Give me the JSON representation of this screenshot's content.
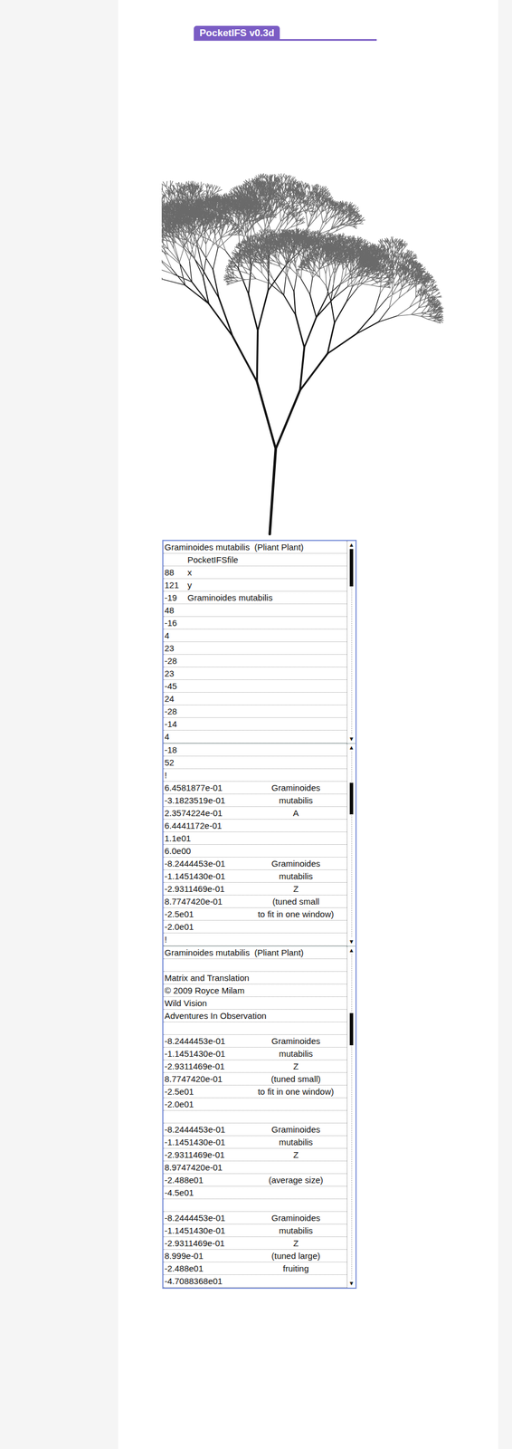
{
  "app": {
    "title": "PocketIFS v0.3d"
  },
  "list": {
    "sections": [
      {
        "kind": "listing",
        "scroll": {
          "up": "▲",
          "down": "▼",
          "level": 0.0,
          "thumb": 0.2
        },
        "rows": [
          {
            "value": "Graminoides mutabilis  (Pliant Plant)",
            "note": ""
          },
          {
            "value": "",
            "note": "PocketIFSfile"
          },
          {
            "value": "88",
            "note": "x"
          },
          {
            "value": "121",
            "note": "y"
          },
          {
            "value": "-19",
            "note": "Graminoides mutabilis"
          },
          {
            "value": "48",
            "note": ""
          },
          {
            "value": "-16",
            "note": ""
          },
          {
            "value": "4",
            "note": ""
          },
          {
            "value": "23",
            "note": ""
          },
          {
            "value": "-28",
            "note": ""
          },
          {
            "value": "23",
            "note": ""
          },
          {
            "value": "-45",
            "note": ""
          },
          {
            "value": "24",
            "note": ""
          },
          {
            "value": "-28",
            "note": ""
          },
          {
            "value": "-14",
            "note": ""
          },
          {
            "value": "4",
            "note": ""
          }
        ]
      },
      {
        "kind": "annotated",
        "scroll": {
          "up": "▲",
          "down": "▼",
          "level": 0.2,
          "thumb": 0.17
        },
        "rows": [
          {
            "value": "-18",
            "note": ""
          },
          {
            "value": "52",
            "note": ""
          },
          {
            "value": "!",
            "note": ""
          },
          {
            "value": "6.4581877e-01",
            "note": "Graminoides"
          },
          {
            "value": "-3.1823519e-01",
            "note": "mutabilis"
          },
          {
            "value": "2.3574224e-01",
            "note": "A"
          },
          {
            "value": "6.4441172e-01",
            "note": ""
          },
          {
            "value": "1.1e01",
            "note": ""
          },
          {
            "value": "6.0e00",
            "note": ""
          },
          {
            "value": "-8.2444453e-01",
            "note": "Graminoides"
          },
          {
            "value": "-1.1451430e-01",
            "note": "mutabilis"
          },
          {
            "value": "-2.9311469e-01",
            "note": "Z"
          },
          {
            "value": "8.7747420e-01",
            "note": "(tuned small"
          },
          {
            "value": "-2.5e01",
            "note": "to fit in one window)"
          },
          {
            "value": "-2.0e01",
            "note": ""
          },
          {
            "value": "!",
            "note": ""
          }
        ]
      },
      {
        "kind": "annotated",
        "scroll": {
          "up": "▲",
          "down": "▼",
          "level": 0.2,
          "thumb": 0.1
        },
        "rows": [
          {
            "value": "Graminoides mutabilis  (Pliant Plant)",
            "note": ""
          },
          {
            "value": "",
            "note": ""
          },
          {
            "value": "Matrix and Translation",
            "note": ""
          },
          {
            "value": "© 2009 Royce Milam",
            "note": ""
          },
          {
            "value": "Wild Vision",
            "note": ""
          },
          {
            "value": "Adventures In Observation",
            "note": ""
          },
          {
            "value": "",
            "note": ""
          },
          {
            "value": "-8.2444453e-01",
            "note": "Graminoides"
          },
          {
            "value": "-1.1451430e-01",
            "note": "mutabilis"
          },
          {
            "value": "-2.9311469e-01",
            "note": "Z"
          },
          {
            "value": "8.7747420e-01",
            "note": "(tuned small)"
          },
          {
            "value": "-2.5e01",
            "note": "to fit in one window)"
          },
          {
            "value": "-2.0e01",
            "note": ""
          },
          {
            "value": "",
            "note": ""
          },
          {
            "value": "-8.2444453e-01",
            "note": "Graminoides"
          },
          {
            "value": "-1.1451430e-01",
            "note": "mutabilis"
          },
          {
            "value": "-2.9311469e-01",
            "note": "Z"
          },
          {
            "value": "8.9747420e-01",
            "note": ""
          },
          {
            "value": "-2.488e01",
            "note": "(average size)"
          },
          {
            "value": "-4.5e01",
            "note": ""
          },
          {
            "value": "",
            "note": ""
          },
          {
            "value": "-8.2444453e-01",
            "note": "Graminoides"
          },
          {
            "value": "-1.1451430e-01",
            "note": "mutabilis"
          },
          {
            "value": "-2.9311469e-01",
            "note": "Z"
          },
          {
            "value": "8.999e-01",
            "note": "(tuned large)"
          },
          {
            "value": "-2.488e01",
            "note": "fruiting"
          },
          {
            "value": "-4.7088368e01",
            "note": ""
          }
        ]
      }
    ]
  }
}
